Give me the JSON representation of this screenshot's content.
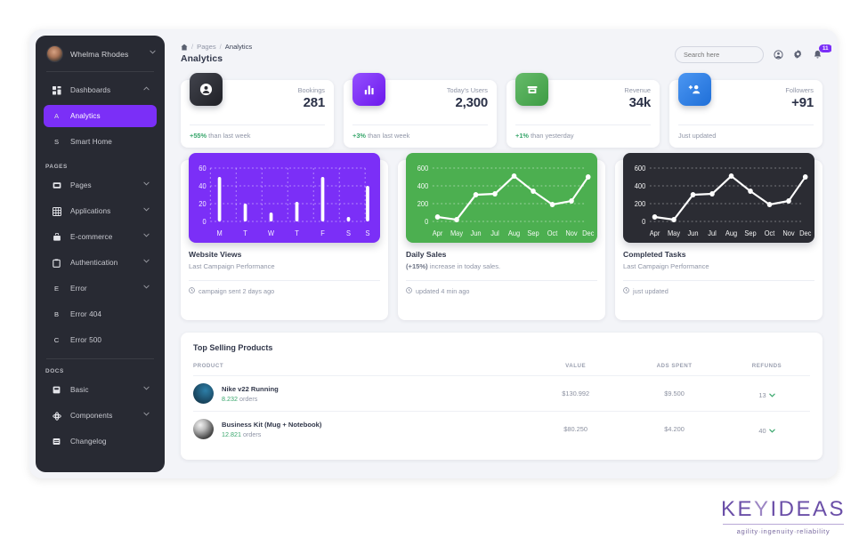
{
  "sidebar": {
    "user": {
      "name": "Whelma Rhodes",
      "chevron": "chevron-down"
    },
    "groups": [
      {
        "label": "",
        "items": [
          {
            "label": "Dashboards",
            "icon": "grid-icon",
            "letter": "",
            "chevron": "^",
            "active": false
          },
          {
            "label": "Analytics",
            "icon": "",
            "letter": "A",
            "chevron": "",
            "active": true
          },
          {
            "label": "Smart Home",
            "icon": "",
            "letter": "S",
            "chevron": "",
            "active": false
          }
        ]
      },
      {
        "label": "PAGES",
        "items": [
          {
            "label": "Pages",
            "icon": "image-icon",
            "letter": "",
            "chevron": "v",
            "active": false
          },
          {
            "label": "Applications",
            "icon": "table-icon",
            "letter": "",
            "chevron": "v",
            "active": false
          },
          {
            "label": "E-commerce",
            "icon": "bag-icon",
            "letter": "",
            "chevron": "v",
            "active": false
          },
          {
            "label": "Authentication",
            "icon": "clipboard-icon",
            "letter": "",
            "chevron": "v",
            "active": false
          },
          {
            "label": "Error",
            "icon": "",
            "letter": "E",
            "chevron": "v",
            "active": false
          },
          {
            "label": "Error 404",
            "icon": "",
            "letter": "B",
            "chevron": "",
            "active": false
          },
          {
            "label": "Error 500",
            "icon": "",
            "letter": "C",
            "chevron": "",
            "active": false
          }
        ]
      },
      {
        "label": "DOCS",
        "items": [
          {
            "label": "Basic",
            "icon": "book-icon",
            "letter": "",
            "chevron": "v",
            "active": false
          },
          {
            "label": "Components",
            "icon": "atom-icon",
            "letter": "",
            "chevron": "v",
            "active": false
          },
          {
            "label": "Changelog",
            "icon": "list-icon",
            "letter": "",
            "chevron": "",
            "active": false
          }
        ]
      }
    ]
  },
  "header": {
    "breadcrumb": {
      "home_icon": "home-icon",
      "sep": "/",
      "parent": "Pages",
      "current": "Analytics"
    },
    "title": "Analytics",
    "search_placeholder": "Search here",
    "account_icon": "account-circle-icon",
    "settings_icon": "gear-icon",
    "bell_icon": "bell-icon",
    "notification_count": "11",
    "accent": "#7b2ff7"
  },
  "stats": [
    {
      "label": "Bookings",
      "value": "281",
      "delta": "+55%",
      "delta_text": "than last week",
      "icon": "person-icon",
      "color": "#2b2c33"
    },
    {
      "label": "Today's Users",
      "value": "2,300",
      "delta": "+3%",
      "delta_text": "than last week",
      "icon": "bar-chart-icon",
      "color": "#7b2ff7"
    },
    {
      "label": "Revenue",
      "value": "34k",
      "delta": "+1%",
      "delta_text": "than yesterday",
      "icon": "store-icon",
      "color": "#4caf50"
    },
    {
      "label": "Followers",
      "value": "+91",
      "delta": "",
      "delta_text": "Just updated",
      "icon": "person-add-icon",
      "color": "#2f80ed"
    }
  ],
  "chart_cards": [
    {
      "title": "Website Views",
      "subtitle": "Last Campaign Performance",
      "footer": "campaign sent 2 days ago",
      "footer_icon": "clock-icon",
      "bg": "#7b2ff7"
    },
    {
      "title": "Daily Sales",
      "subtitle_bold": "(+15%)",
      "subtitle": " increase in today sales.",
      "footer": "updated 4 min ago",
      "footer_icon": "clock-icon",
      "bg": "#4caf50"
    },
    {
      "title": "Completed Tasks",
      "subtitle": "Last Campaign Performance",
      "footer": "just updated",
      "footer_icon": "clock-icon",
      "bg": "#2b2c33"
    }
  ],
  "chart_data": [
    {
      "type": "bar",
      "title": "Website Views",
      "categories": [
        "M",
        "T",
        "W",
        "T",
        "F",
        "S",
        "S"
      ],
      "values": [
        50,
        20,
        10,
        22,
        50,
        5,
        40
      ],
      "yticks": [
        0,
        20,
        40,
        60
      ],
      "ylim": [
        0,
        60
      ],
      "xlabel": "",
      "ylabel": "",
      "grid": true,
      "series_color": "#ffffff",
      "plot_bg": "#7b2ff7"
    },
    {
      "type": "line",
      "title": "Daily Sales",
      "categories": [
        "Apr",
        "May",
        "Jun",
        "Jul",
        "Aug",
        "Sep",
        "Oct",
        "Nov",
        "Dec"
      ],
      "values": [
        50,
        20,
        300,
        310,
        510,
        340,
        190,
        225,
        500
      ],
      "yticks": [
        0,
        200,
        400,
        600
      ],
      "ylim": [
        0,
        600
      ],
      "xlabel": "",
      "ylabel": "",
      "grid": true,
      "series_color": "#ffffff",
      "plot_bg": "#4caf50"
    },
    {
      "type": "line",
      "title": "Completed Tasks",
      "categories": [
        "Apr",
        "May",
        "Jun",
        "Jul",
        "Aug",
        "Sep",
        "Oct",
        "Nov",
        "Dec"
      ],
      "values": [
        50,
        20,
        300,
        310,
        510,
        340,
        190,
        225,
        500
      ],
      "yticks": [
        0,
        200,
        400,
        600
      ],
      "ylim": [
        0,
        600
      ],
      "xlabel": "",
      "ylabel": "",
      "grid": true,
      "series_color": "#ffffff",
      "plot_bg": "#2b2c33"
    }
  ],
  "table": {
    "title_a": "Top",
    "title_b": "Selling Products",
    "columns": [
      "PRODUCT",
      "VALUE",
      "ADS SPENT",
      "REFUNDS"
    ],
    "rows": [
      {
        "name": "Nike v22 Running",
        "orders": "8.232",
        "orders_suffix": " orders",
        "value": "$130.992",
        "ads": "$9.500",
        "refunds": "13",
        "refund_dir": "down",
        "thumb": "shoe"
      },
      {
        "name": "Business Kit (Mug + Notebook)",
        "orders": "12.821",
        "orders_suffix": " orders",
        "value": "$80.250",
        "ads": "$4.200",
        "refunds": "40",
        "refund_dir": "down",
        "thumb": "kit"
      }
    ]
  },
  "brand": {
    "word_a": "KE",
    "word_b": "Y",
    "word_c": "IDEAS",
    "tagline": "agility·ingenuity·reliability"
  }
}
